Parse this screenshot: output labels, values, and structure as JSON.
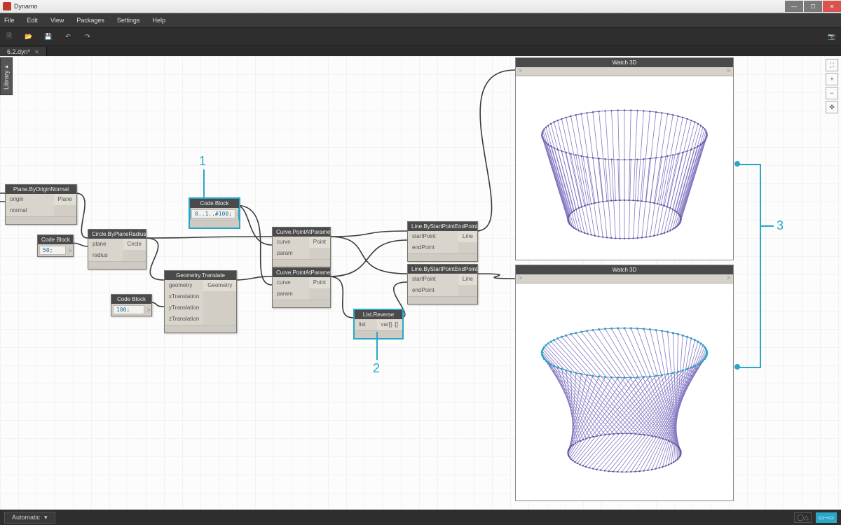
{
  "app_title": "Dynamo",
  "menu": {
    "file": "File",
    "edit": "Edit",
    "view": "View",
    "packages": "Packages",
    "settings": "Settings",
    "help": "Help"
  },
  "tab": {
    "name": "6.2.dyn*"
  },
  "library_label": "Library",
  "zoom": {
    "fit": "⛶",
    "in": "+",
    "out": "−",
    "target": "✜"
  },
  "toolbar_icons": {
    "new": "🗎",
    "open": "📂",
    "save": "💾",
    "undo": "↶",
    "redo": "↷",
    "camera": "📷"
  },
  "status": {
    "run_mode": "Automatic",
    "caret": "▾"
  },
  "annotations": {
    "n1": "1",
    "n2": "2",
    "n3": "3"
  },
  "nodes": {
    "plane": {
      "title": "Plane.ByOriginNormal",
      "in": [
        "origin",
        "normal"
      ],
      "out": [
        "Plane"
      ]
    },
    "circle": {
      "title": "Circle.ByPlaneRadius",
      "in": [
        "plane",
        "radius"
      ],
      "out": [
        "Circle"
      ]
    },
    "cb1": {
      "title": "Code Block",
      "code": "50;",
      "chev": ">"
    },
    "cb2": {
      "title": "Code Block",
      "code": "0..1..#100;",
      "chev": ">"
    },
    "cb3": {
      "title": "Code Block",
      "code": "100;",
      "chev": ">"
    },
    "geo": {
      "title": "Geometry.Translate",
      "in": [
        "geometry",
        "xTranslation",
        "yTranslation",
        "zTranslation"
      ],
      "out": [
        "Geometry"
      ]
    },
    "pap1": {
      "title": "Curve.PointAtParameter",
      "in": [
        "curve",
        "param"
      ],
      "out": [
        "Point"
      ]
    },
    "pap2": {
      "title": "Curve.PointAtParameter",
      "in": [
        "curve",
        "param"
      ],
      "out": [
        "Point"
      ]
    },
    "rev": {
      "title": "List.Reverse",
      "in": [
        "list"
      ],
      "out": [
        "var[]..[]"
      ]
    },
    "ln1": {
      "title": "Line.ByStartPointEndPoint",
      "in": [
        "startPoint",
        "endPoint"
      ],
      "out": [
        "Line"
      ]
    },
    "ln2": {
      "title": "Line.ByStartPointEndPoint",
      "in": [
        "startPoint",
        "endPoint"
      ],
      "out": [
        "Line"
      ]
    },
    "w1": {
      "title": "Watch 3D"
    },
    "w2": {
      "title": "Watch 3D"
    }
  },
  "colors": {
    "accent": "#2aa7c7",
    "wire": "#3a3a3a",
    "geom": "#6a5fa8",
    "pts": "#2aa7c7"
  }
}
